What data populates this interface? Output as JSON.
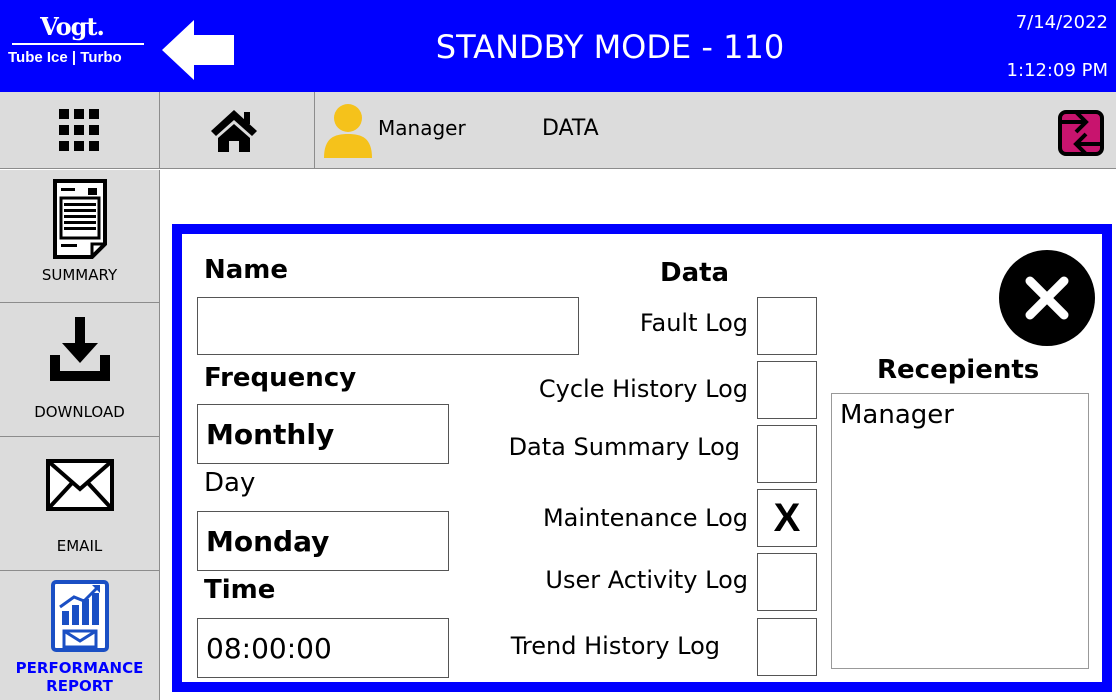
{
  "header": {
    "logo_top": "Vogt.",
    "logo_bottom": "Tube Ice | Turbo",
    "title": "STANDBY MODE - 110",
    "date": "7/14/2022",
    "time": "1:12:09 PM"
  },
  "toolbar": {
    "user": "Manager",
    "page": "DATA"
  },
  "sidebar": {
    "items": [
      {
        "label": "SUMMARY",
        "icon": "summary-document-icon"
      },
      {
        "label": "DOWNLOAD",
        "icon": "download-icon"
      },
      {
        "label": "EMAIL",
        "icon": "email-icon"
      },
      {
        "label": "PERFORMANCE REPORT",
        "icon": "performance-report-icon"
      }
    ]
  },
  "form": {
    "name_label": "Name",
    "name_value": "",
    "frequency_label": "Frequency",
    "frequency_value": "Monthly",
    "day_label": "Day",
    "day_value": "Monday",
    "time_label": "Time",
    "time_value": "08:00:00",
    "data_label": "Data",
    "logs": [
      {
        "label": "Fault Log",
        "checked": ""
      },
      {
        "label": "Cycle History Log",
        "checked": ""
      },
      {
        "label": "Data Summary Log",
        "checked": ""
      },
      {
        "label": "Maintenance Log",
        "checked": "X"
      },
      {
        "label": "User Activity Log",
        "checked": ""
      },
      {
        "label": "Trend History Log",
        "checked": ""
      }
    ],
    "recipients_label": "Recepients",
    "recipients": [
      "Manager"
    ]
  },
  "colors": {
    "header_blue": "#0000ff",
    "toolbar_gray": "#dcdcdc",
    "user_yellow": "#f5c21b",
    "switch_magenta": "#c8146e"
  }
}
